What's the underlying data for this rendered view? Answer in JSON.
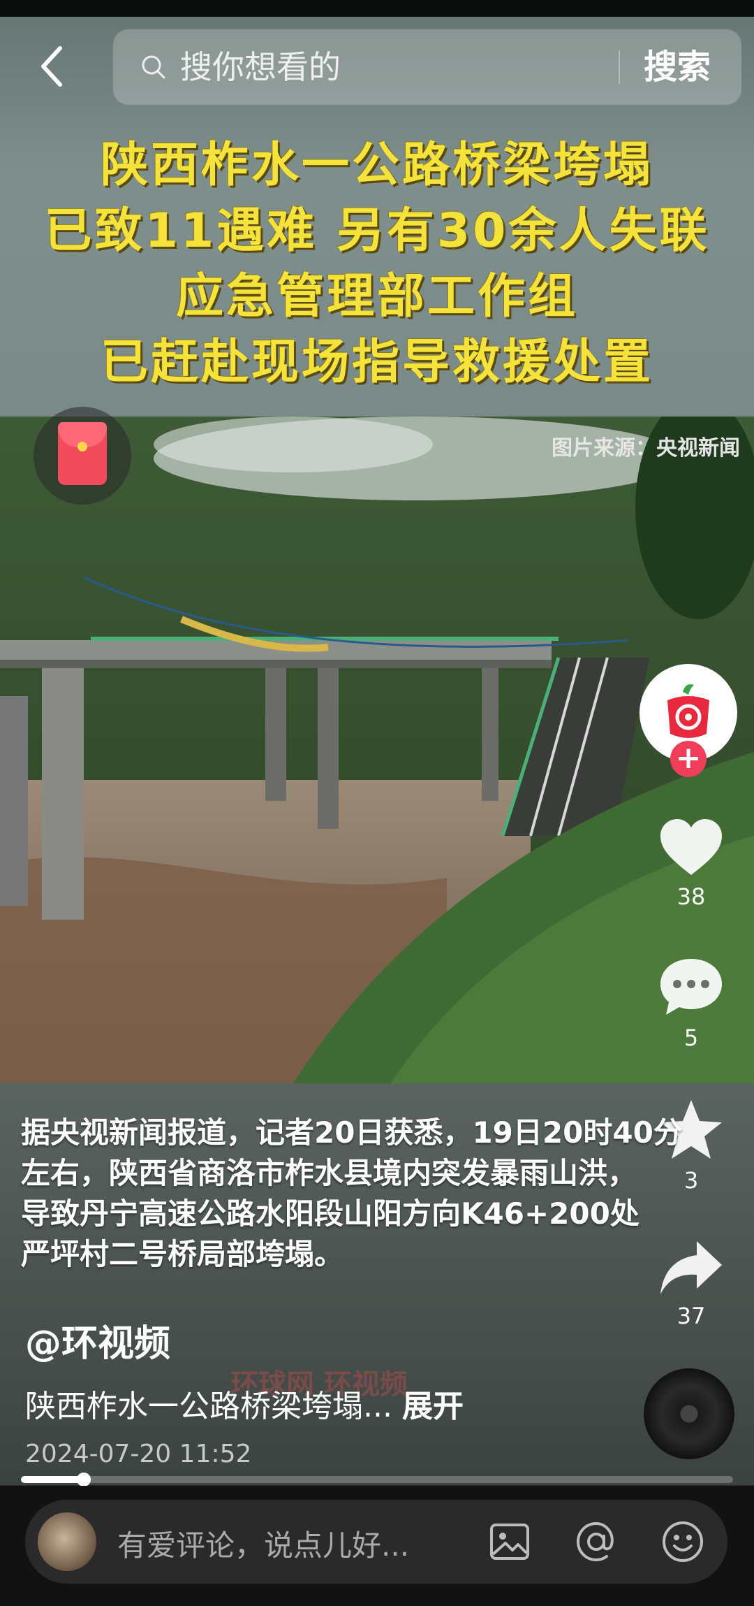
{
  "header": {
    "search_placeholder": "搜你想看的",
    "search_button": "搜索"
  },
  "video": {
    "headline": [
      "陕西柞水一公路桥梁垮塌",
      "已致11遇难  另有30余人失联",
      "应急管理部工作组",
      "已赶赴现场指导救援处置"
    ],
    "photo_source": "图片来源：央视新闻",
    "caption": [
      "据央视新闻报道，记者20日获悉，19日20时40分",
      "左右，陕西省商洛市柞水县境内突发暴雨山洪，",
      "导致丹宁高速公路水阳段山阳方向K46+200处",
      "严坪村二号桥局部垮塌。"
    ],
    "author": "@环视频",
    "title": "陕西柞水一公路桥梁垮塌...",
    "expand": "展开",
    "date": "2024-07-20 11:52",
    "watermark": "环球网  环视频",
    "progress": 0.088
  },
  "actions": {
    "likes": "38",
    "comments": "5",
    "favorites": "3",
    "shares": "37",
    "follow_plus": "+"
  },
  "comment_bar": {
    "placeholder": "有爱评论，说点儿好..."
  },
  "colors": {
    "headline": "#f5e23a",
    "accent_red": "#f03e5a"
  }
}
